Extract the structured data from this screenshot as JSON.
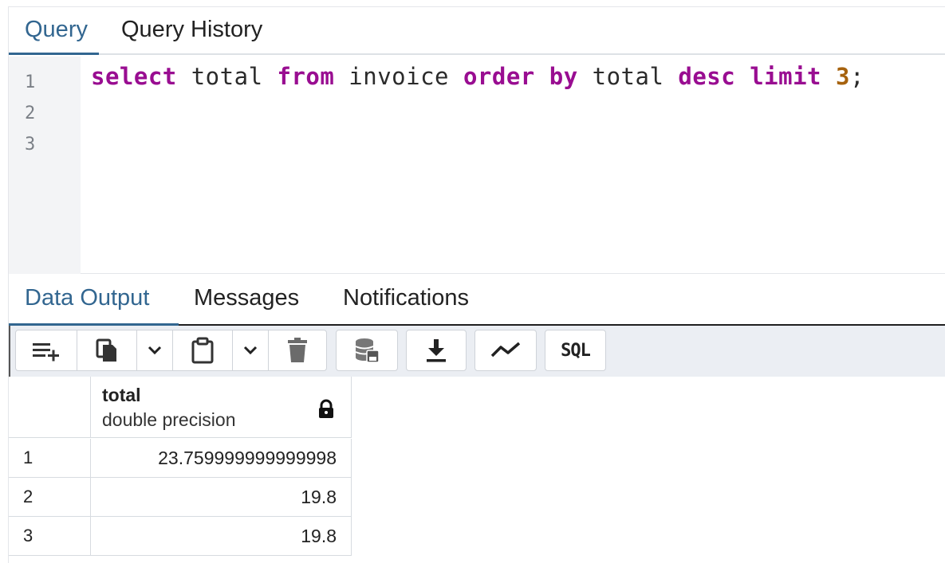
{
  "query_tabs": [
    {
      "label": "Query",
      "active": true
    },
    {
      "label": "Query History",
      "active": false
    }
  ],
  "editor": {
    "line_numbers": [
      "1",
      "2",
      "3"
    ],
    "code_tokens": [
      {
        "text": "select",
        "type": "keyword"
      },
      {
        "text": " total ",
        "type": "plain"
      },
      {
        "text": "from",
        "type": "keyword"
      },
      {
        "text": " invoice ",
        "type": "plain"
      },
      {
        "text": "order",
        "type": "keyword"
      },
      {
        "text": " ",
        "type": "plain"
      },
      {
        "text": "by",
        "type": "keyword"
      },
      {
        "text": " total ",
        "type": "plain"
      },
      {
        "text": "desc",
        "type": "keyword"
      },
      {
        "text": " ",
        "type": "plain"
      },
      {
        "text": "limit",
        "type": "keyword"
      },
      {
        "text": " ",
        "type": "plain"
      },
      {
        "text": "3",
        "type": "number"
      },
      {
        "text": ";",
        "type": "plain"
      }
    ]
  },
  "output_tabs": [
    {
      "label": "Data Output",
      "active": true
    },
    {
      "label": "Messages",
      "active": false
    },
    {
      "label": "Notifications",
      "active": false
    }
  ],
  "toolbar": {
    "buttons": [
      {
        "name": "add-row-button",
        "icon": "add-row-icon"
      },
      {
        "name": "copy-button",
        "icon": "copy-icon"
      },
      {
        "name": "copy-options-button",
        "icon": "chevron-down-icon"
      },
      {
        "name": "paste-button",
        "icon": "paste-icon"
      },
      {
        "name": "paste-options-button",
        "icon": "chevron-down-icon"
      },
      {
        "name": "delete-button",
        "icon": "trash-icon"
      },
      {
        "name": "save-data-button",
        "icon": "database-save-icon"
      },
      {
        "name": "download-button",
        "icon": "download-icon"
      },
      {
        "name": "graph-visualiser-button",
        "icon": "line-chart-icon"
      },
      {
        "name": "sql-button",
        "icon": "sql-icon"
      }
    ],
    "sql_label": "SQL"
  },
  "grid": {
    "column": {
      "name": "total",
      "type": "double precision",
      "locked": true
    },
    "rows": [
      {
        "row_number": "1",
        "value": "23.759999999999998"
      },
      {
        "row_number": "2",
        "value": "19.8"
      },
      {
        "row_number": "3",
        "value": "19.8"
      }
    ]
  },
  "colors": {
    "accent": "#326690",
    "keyword": "#990d91",
    "number": "#a6620e",
    "toolbar_bg": "#ebeef3",
    "gutter_bg": "#f3f4f6"
  }
}
